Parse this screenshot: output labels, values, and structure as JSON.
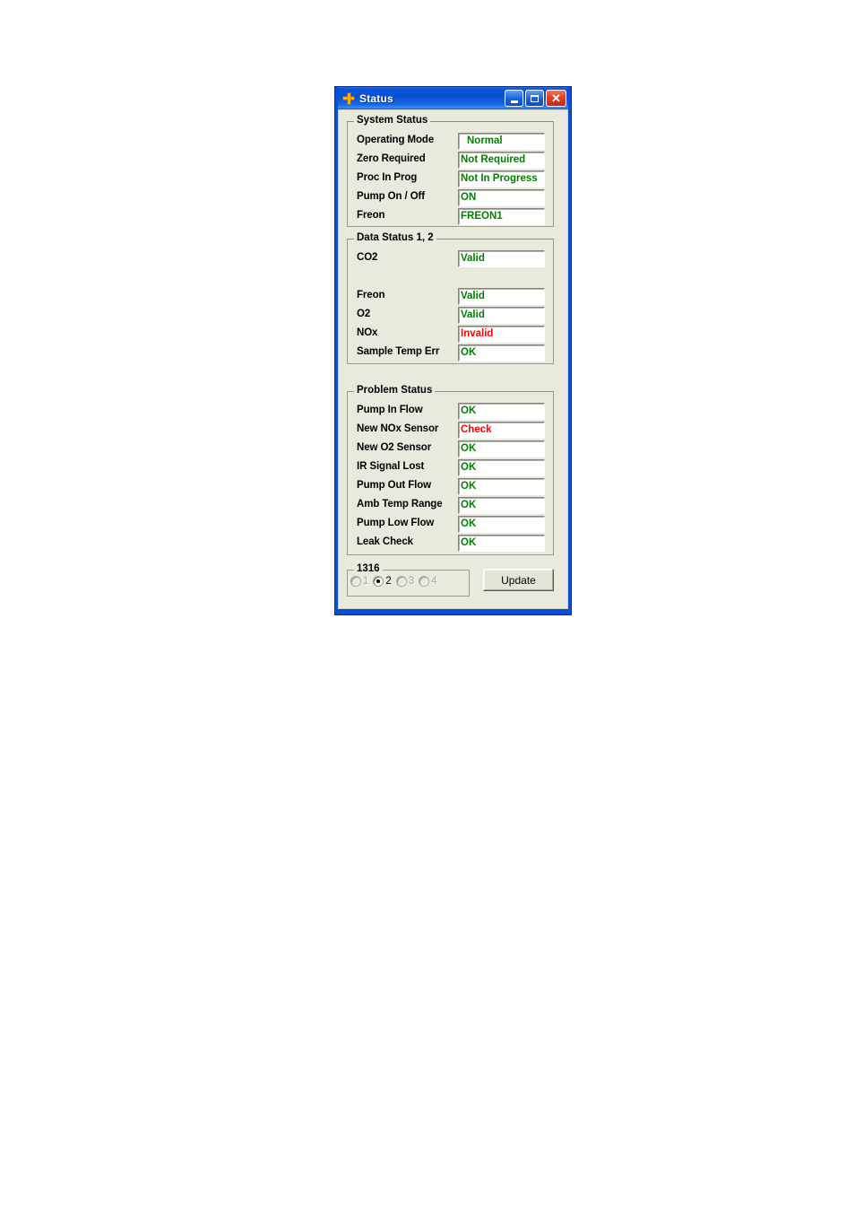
{
  "window": {
    "title": "Status",
    "icon": "crosshair-icon",
    "caption_buttons": {
      "minimize": "minimize-icon",
      "maximize": "maximize-icon",
      "close": "close-icon"
    }
  },
  "colors": {
    "titlebar": "#0a4fd4",
    "client_background": "#e9e9dd",
    "ok_green": "#008000",
    "alert_red": "#ff0000",
    "field_background": "#ffffff"
  },
  "groups": {
    "system_status": {
      "title": "System Status",
      "rows": [
        {
          "label": "Operating Mode",
          "value": "Normal",
          "state": "ok",
          "indent": true
        },
        {
          "label": "Zero Required",
          "value": "Not Required",
          "state": "ok",
          "indent": false
        },
        {
          "label": "Proc In Prog",
          "value": "Not In Progress",
          "state": "ok",
          "indent": false
        },
        {
          "label": "Pump On / Off",
          "value": "ON",
          "state": "ok",
          "indent": false
        },
        {
          "label": "Freon",
          "value": "FREON1",
          "state": "ok",
          "indent": false
        }
      ]
    },
    "data_status": {
      "title": "Data Status 1, 2",
      "rows": [
        {
          "label": "CO2",
          "value": "Valid",
          "state": "ok",
          "indent": false
        },
        {
          "label": "",
          "value": "",
          "state": "none",
          "indent": false
        },
        {
          "label": "Freon",
          "value": "Valid",
          "state": "ok",
          "indent": false
        },
        {
          "label": "O2",
          "value": "Valid",
          "state": "ok",
          "indent": false
        },
        {
          "label": "NOx",
          "value": "Invalid",
          "state": "alert",
          "indent": false
        },
        {
          "label": "Sample Temp Err",
          "value": "OK",
          "state": "ok",
          "indent": false
        }
      ]
    },
    "problem_status": {
      "title": "Problem Status",
      "rows": [
        {
          "label": "Pump In Flow",
          "value": "OK",
          "state": "ok",
          "indent": false
        },
        {
          "label": "New NOx Sensor",
          "value": "Check",
          "state": "alert",
          "indent": false
        },
        {
          "label": "New O2 Sensor",
          "value": "OK",
          "state": "ok",
          "indent": false
        },
        {
          "label": "IR Signal Lost",
          "value": "OK",
          "state": "ok",
          "indent": false
        },
        {
          "label": "Pump Out Flow",
          "value": "OK",
          "state": "ok",
          "indent": false
        },
        {
          "label": "Amb Temp Range",
          "value": "OK",
          "state": "ok",
          "indent": false
        },
        {
          "label": "Pump Low Flow",
          "value": "OK",
          "state": "ok",
          "indent": false
        },
        {
          "label": "Leak Check",
          "value": "OK",
          "state": "ok",
          "indent": false
        }
      ]
    },
    "selector": {
      "title": "1316",
      "options": [
        {
          "label": "1",
          "selected": false,
          "enabled": false
        },
        {
          "label": "2",
          "selected": true,
          "enabled": true
        },
        {
          "label": "3",
          "selected": false,
          "enabled": false
        },
        {
          "label": "4",
          "selected": false,
          "enabled": false
        }
      ]
    }
  },
  "buttons": {
    "update": "Update"
  }
}
